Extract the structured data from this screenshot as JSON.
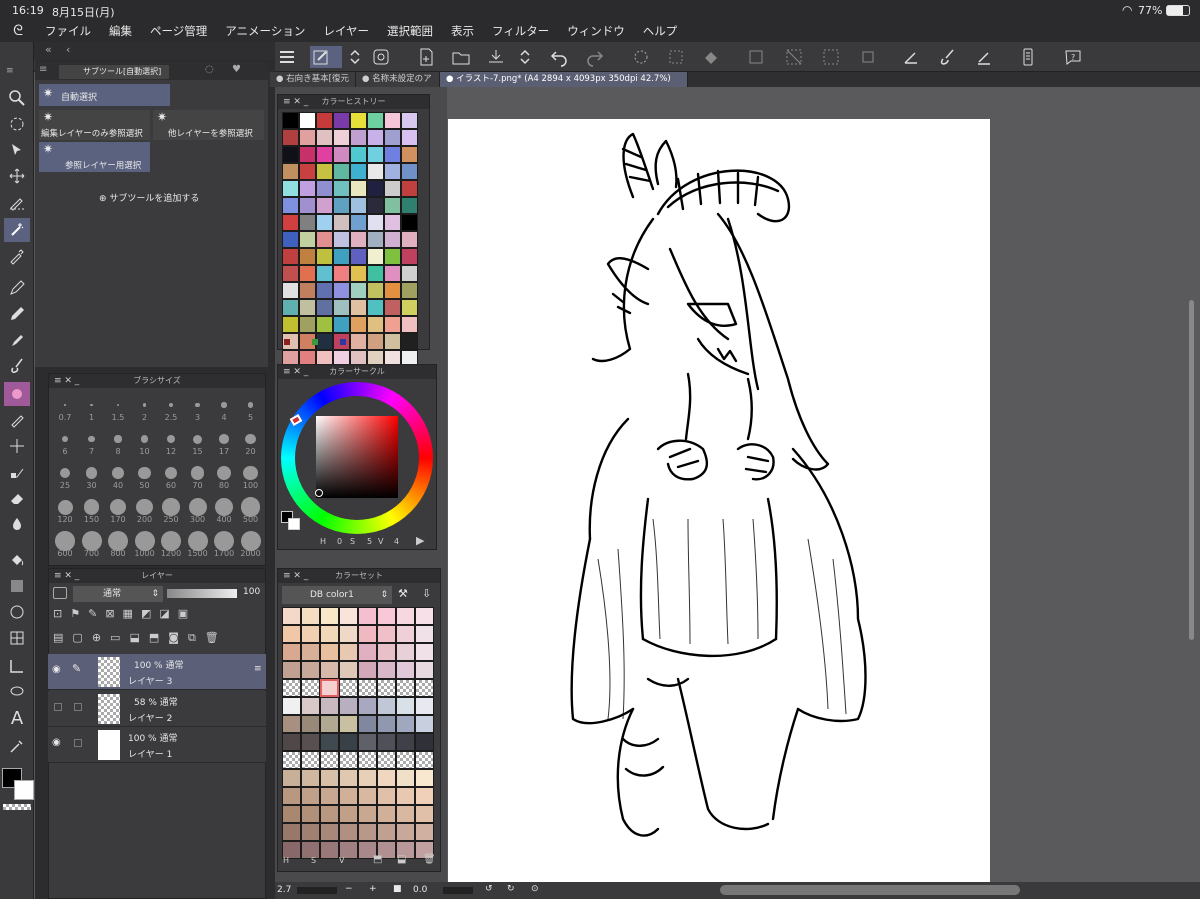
{
  "status": {
    "time": "16:19",
    "date": "8月15日(月)",
    "battery": "77%"
  },
  "menu": [
    "ファイル",
    "編集",
    "ページ管理",
    "アニメーション",
    "レイヤー",
    "選択範囲",
    "表示",
    "フィルター",
    "ウィンドウ",
    "ヘルプ"
  ],
  "tabs": [
    {
      "label": "右向き基本[復元"
    },
    {
      "label": "名称未設定のア"
    },
    {
      "label": "イラスト-7.png* (A4 2894 x 4093px 350dpi 42.7%)"
    }
  ],
  "subtool": {
    "header": "サブツール[自動選択]",
    "items": [
      "自動選択",
      "編集レイヤーのみ参照選択",
      "他レイヤーを参照選択",
      "参照レイヤー用選択"
    ],
    "add_label": "サブツールを追加する"
  },
  "color_history": {
    "title": "カラーヒストリー"
  },
  "color_circle": {
    "title": "カラーサークル",
    "h_label": "H",
    "h": "0",
    "s_label": "S",
    "s": "5",
    "v_label": "V",
    "v": "4"
  },
  "brush_size": {
    "title": "ブラシサイズ",
    "sizes": [
      "0.7",
      "1",
      "1.5",
      "2",
      "2.5",
      "3",
      "4",
      "5",
      "6",
      "7",
      "8",
      "10",
      "12",
      "15",
      "17",
      "20",
      "25",
      "30",
      "40",
      "50",
      "60",
      "70",
      "80",
      "100",
      "120",
      "150",
      "170",
      "200",
      "250",
      "300",
      "400",
      "500",
      "600",
      "700",
      "800",
      "1000",
      "1200",
      "1500",
      "1700",
      "2000"
    ]
  },
  "layers": {
    "title": "レイヤー",
    "blend": "通常",
    "opacity": "100",
    "rows": [
      {
        "opacity_mode": "100 % 通常",
        "name": "レイヤー 3"
      },
      {
        "opacity_mode": "58 % 通常",
        "name": "レイヤー 2"
      },
      {
        "opacity_mode": "100 % 通常",
        "name": "レイヤー 1"
      }
    ]
  },
  "color_set": {
    "title": "カラーセット",
    "set_name": "DB color1",
    "footer": [
      "H",
      "S",
      "V"
    ]
  },
  "bottom": {
    "zoom": "2.7",
    "rotation": "0.0"
  },
  "colors": {
    "accent": "#5b6280",
    "panel": "#3b3b3d",
    "chrome": "#2b2b2d"
  }
}
